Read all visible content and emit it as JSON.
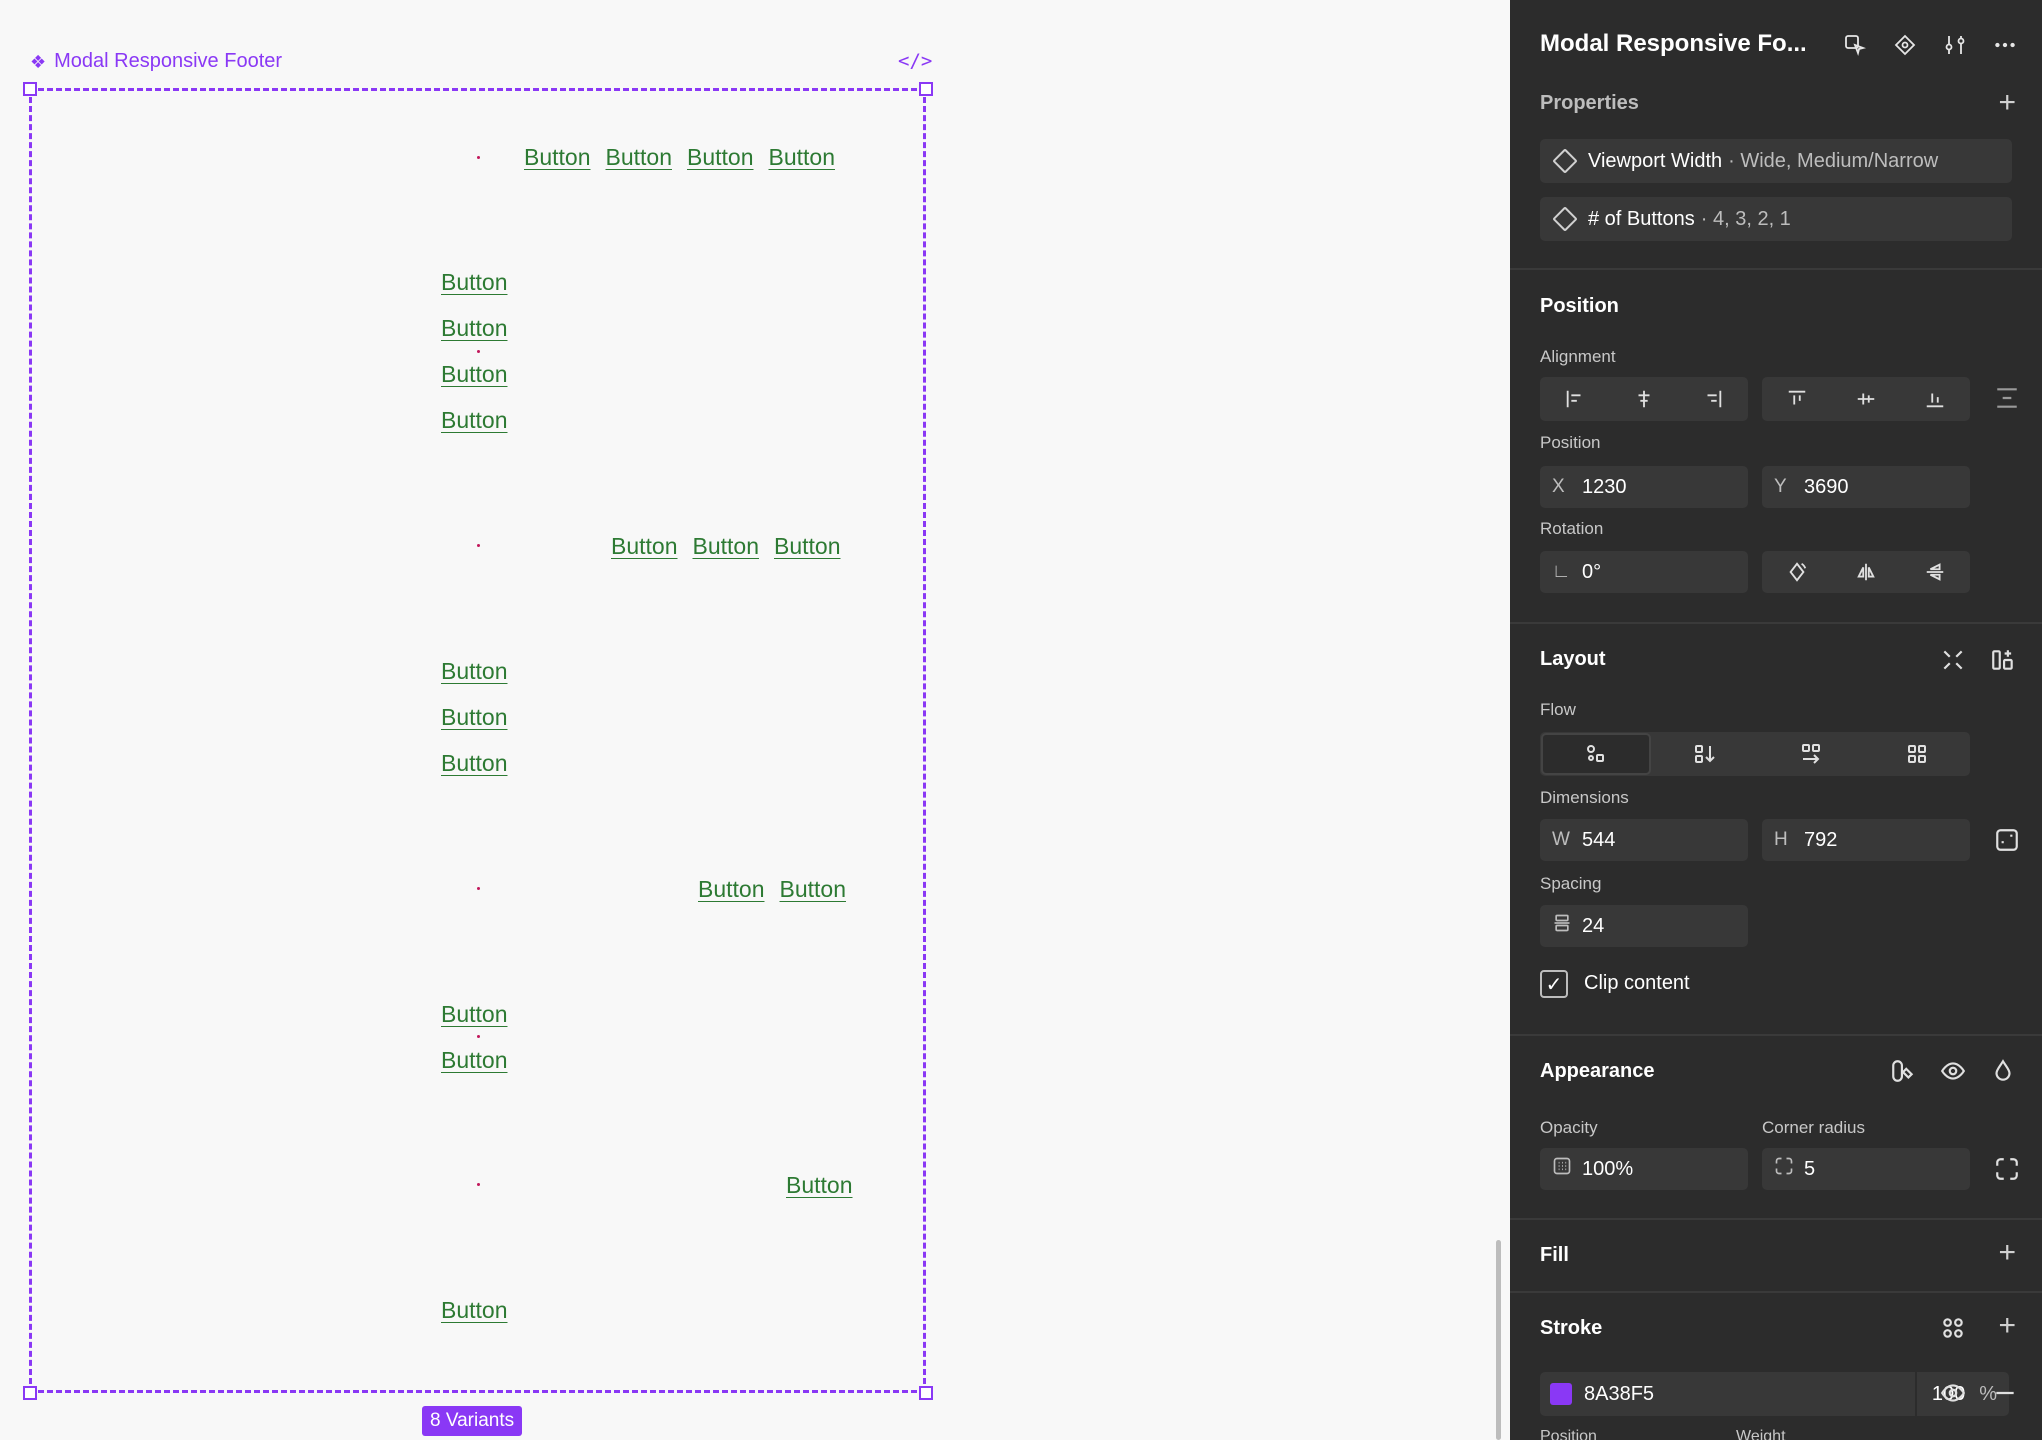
{
  "canvas": {
    "set_name": "Modal Responsive Footer",
    "code_icon": "code-icon",
    "variants_label": "8 Variants",
    "button_label": "Button",
    "accent": "#8a38f5",
    "button_color": "#2d7a33"
  },
  "panel": {
    "title": "Modal Responsive Fo...",
    "header_icons": [
      "select-matching-icon",
      "component-icon",
      "adjust-icon",
      "more-icon"
    ],
    "properties": {
      "title": "Properties",
      "items": [
        {
          "name": "Viewport Width",
          "value": "· Wide, Medium/Narrow"
        },
        {
          "name": "# of Buttons",
          "value": "· 4, 3, 2, 1"
        }
      ]
    },
    "position": {
      "title": "Position",
      "alignment_label": "Alignment",
      "position_label": "Position",
      "x_label": "X",
      "x": "1230",
      "y_label": "Y",
      "y": "3690",
      "rotation_label": "Rotation",
      "rotation": "0°"
    },
    "layout": {
      "title": "Layout",
      "flow_label": "Flow",
      "dimensions_label": "Dimensions",
      "w_label": "W",
      "w": "544",
      "h_label": "H",
      "h": "792",
      "spacing_label": "Spacing",
      "spacing": "24",
      "clip_content": "Clip content"
    },
    "appearance": {
      "title": "Appearance",
      "opacity_label": "Opacity",
      "opacity": "100%",
      "radius_label": "Corner radius",
      "radius": "5"
    },
    "fill": {
      "title": "Fill"
    },
    "stroke": {
      "title": "Stroke",
      "color": "8A38F5",
      "opacity": "100",
      "unit": "%",
      "position_label": "Position",
      "weight_label": "Weight"
    }
  }
}
